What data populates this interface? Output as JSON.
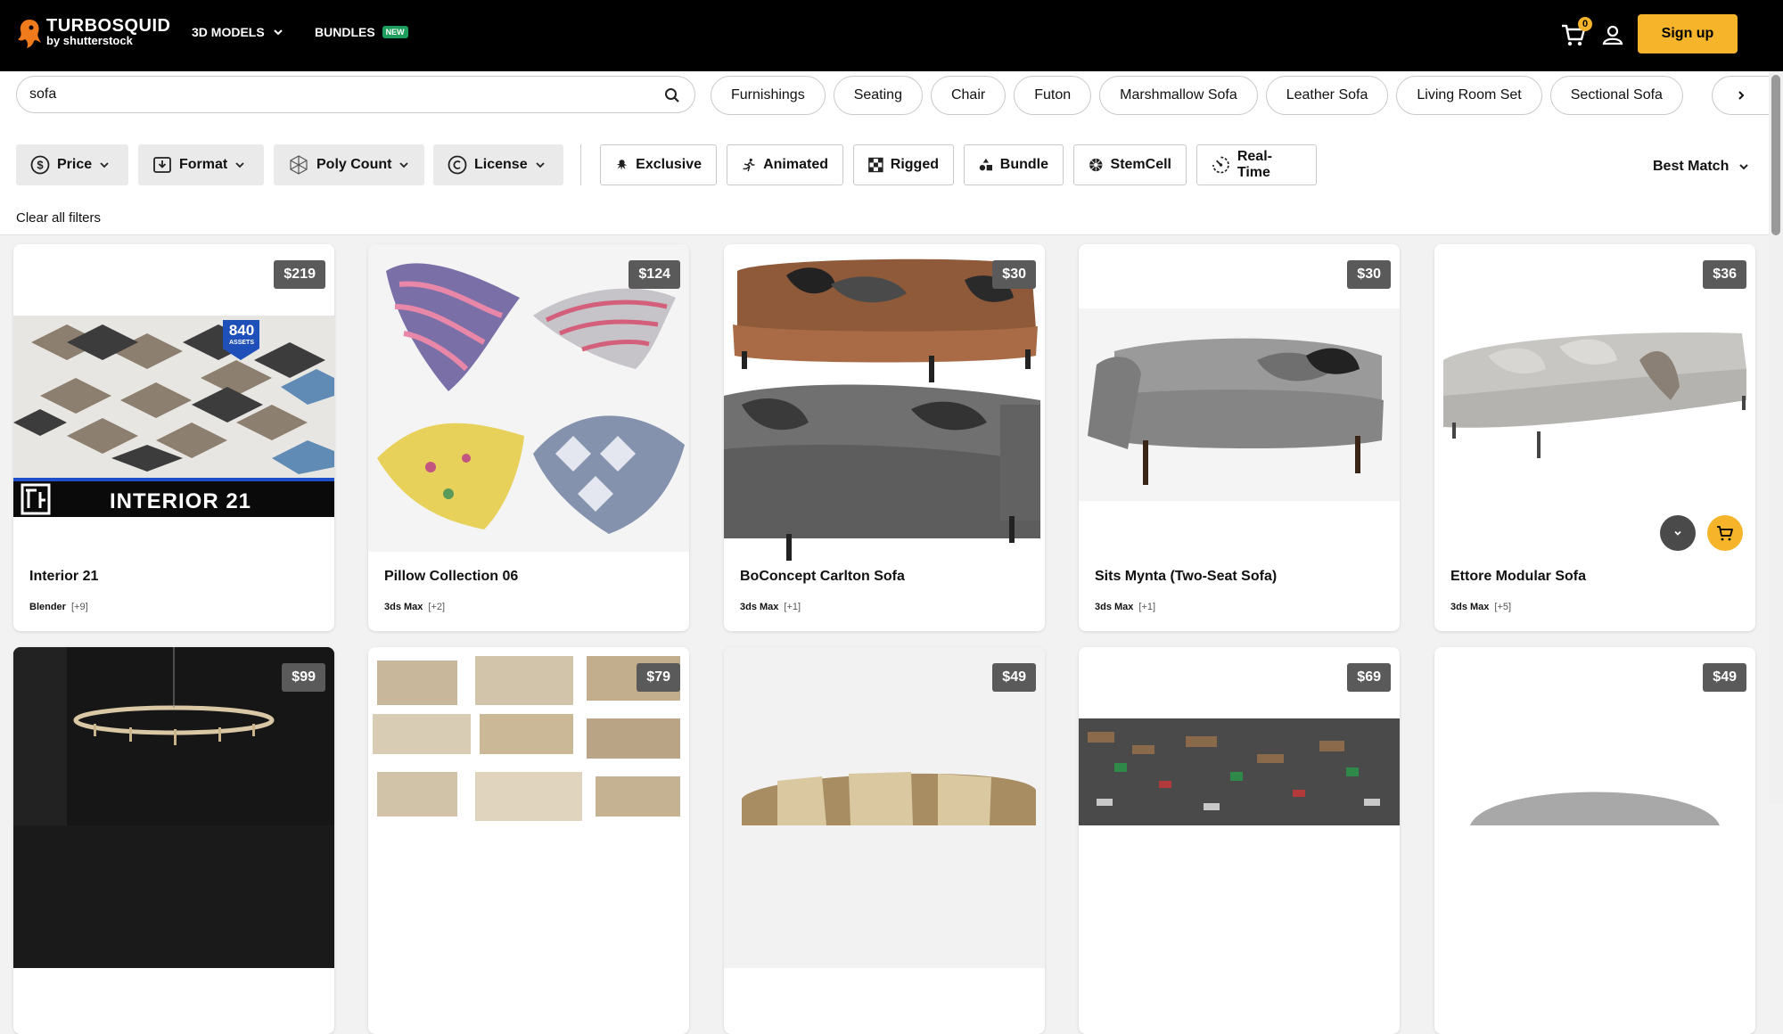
{
  "header": {
    "logo_text": "TURBOSQUID",
    "logo_sub": "by shutterstock",
    "nav_models": "3D MODELS",
    "nav_bundles": "BUNDLES",
    "new_badge": "NEW",
    "cart_count": "0",
    "signup": "Sign up"
  },
  "search": {
    "value": "sofa",
    "placeholder": ""
  },
  "chips": [
    "Furnishings",
    "Seating",
    "Chair",
    "Futon",
    "Marshmallow Sofa",
    "Leather Sofa",
    "Living Room Set",
    "Sectional Sofa"
  ],
  "filters": {
    "price": "Price",
    "format": "Format",
    "poly": "Poly Count",
    "license": "License",
    "exclusive": "Exclusive",
    "animated": "Animated",
    "rigged": "Rigged",
    "bundle": "Bundle",
    "stemcell": "StemCell",
    "realtime": "Real-Time",
    "clear": "Clear all filters",
    "sort": "Best Match"
  },
  "products": [
    {
      "title": "Interior 21",
      "price": "$219",
      "format": "Blender",
      "more": "[+9]",
      "overlay_badge": "840",
      "overlay_badge_sub": "ASSETS",
      "overlay_caption": "INTERIOR 21"
    },
    {
      "title": "Pillow Collection 06",
      "price": "$124",
      "format": "3ds Max",
      "more": "[+2]"
    },
    {
      "title": "BoConcept Carlton Sofa",
      "price": "$30",
      "format": "3ds Max",
      "more": "[+1]"
    },
    {
      "title": "Sits Mynta (Two-Seat Sofa)",
      "price": "$30",
      "format": "3ds Max",
      "more": "[+1]"
    },
    {
      "title": "Ettore Modular Sofa",
      "price": "$36",
      "format": "3ds Max",
      "more": "[+5]"
    },
    {
      "price": "$99"
    },
    {
      "price": "$79"
    },
    {
      "price": "$49"
    },
    {
      "price": "$69"
    },
    {
      "price": "$49"
    }
  ]
}
